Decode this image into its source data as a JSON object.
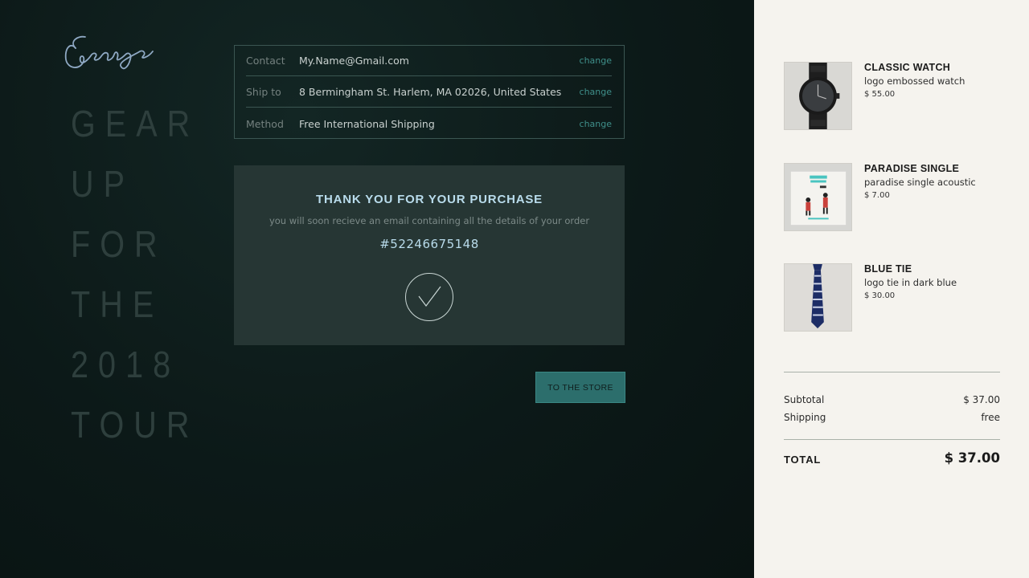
{
  "brand": {
    "logo_text": "George"
  },
  "tagline": [
    "GEAR",
    "UP",
    "FOR",
    "THE",
    "2018",
    "TOUR"
  ],
  "info": {
    "rows": [
      {
        "label": "Contact",
        "value": "My.Name@Gmail.com",
        "action": "change"
      },
      {
        "label": "Ship to",
        "value": "8 Bermingham St. Harlem, MA 02026, United States",
        "action": "change"
      },
      {
        "label": "Method",
        "value": "Free International Shipping",
        "action": "change"
      }
    ]
  },
  "confirmation": {
    "title": "THANK YOU FOR YOUR PURCHASE",
    "subtitle": "you will soon recieve an email containing all the details of your order",
    "order_number": "#52246675148",
    "icon": "checkmark-circle-icon"
  },
  "store_button": {
    "label": "TO THE STORE"
  },
  "cart": {
    "items": [
      {
        "name": "CLASSIC WATCH",
        "description": "logo embossed watch",
        "price": "$ 55.00",
        "icon": "watch-icon"
      },
      {
        "name": "PARADISE SINGLE",
        "description": "paradise single acoustic",
        "price": "$ 7.00",
        "icon": "album-cover-icon"
      },
      {
        "name": "BLUE TIE",
        "description": "logo tie in dark blue",
        "price": "$ 30.00",
        "icon": "tie-icon"
      }
    ],
    "subtotal_label": "Subtotal",
    "subtotal_value": "$ 37.00",
    "shipping_label": "Shipping",
    "shipping_value": "free",
    "total_label": "TOTAL",
    "total_value": "$ 37.00"
  },
  "colors": {
    "accent": "#2c6e6c",
    "dark_bg": "#0d1a19",
    "panel_bg": "#f5f3ee",
    "title_blue": "#b9dcec"
  }
}
